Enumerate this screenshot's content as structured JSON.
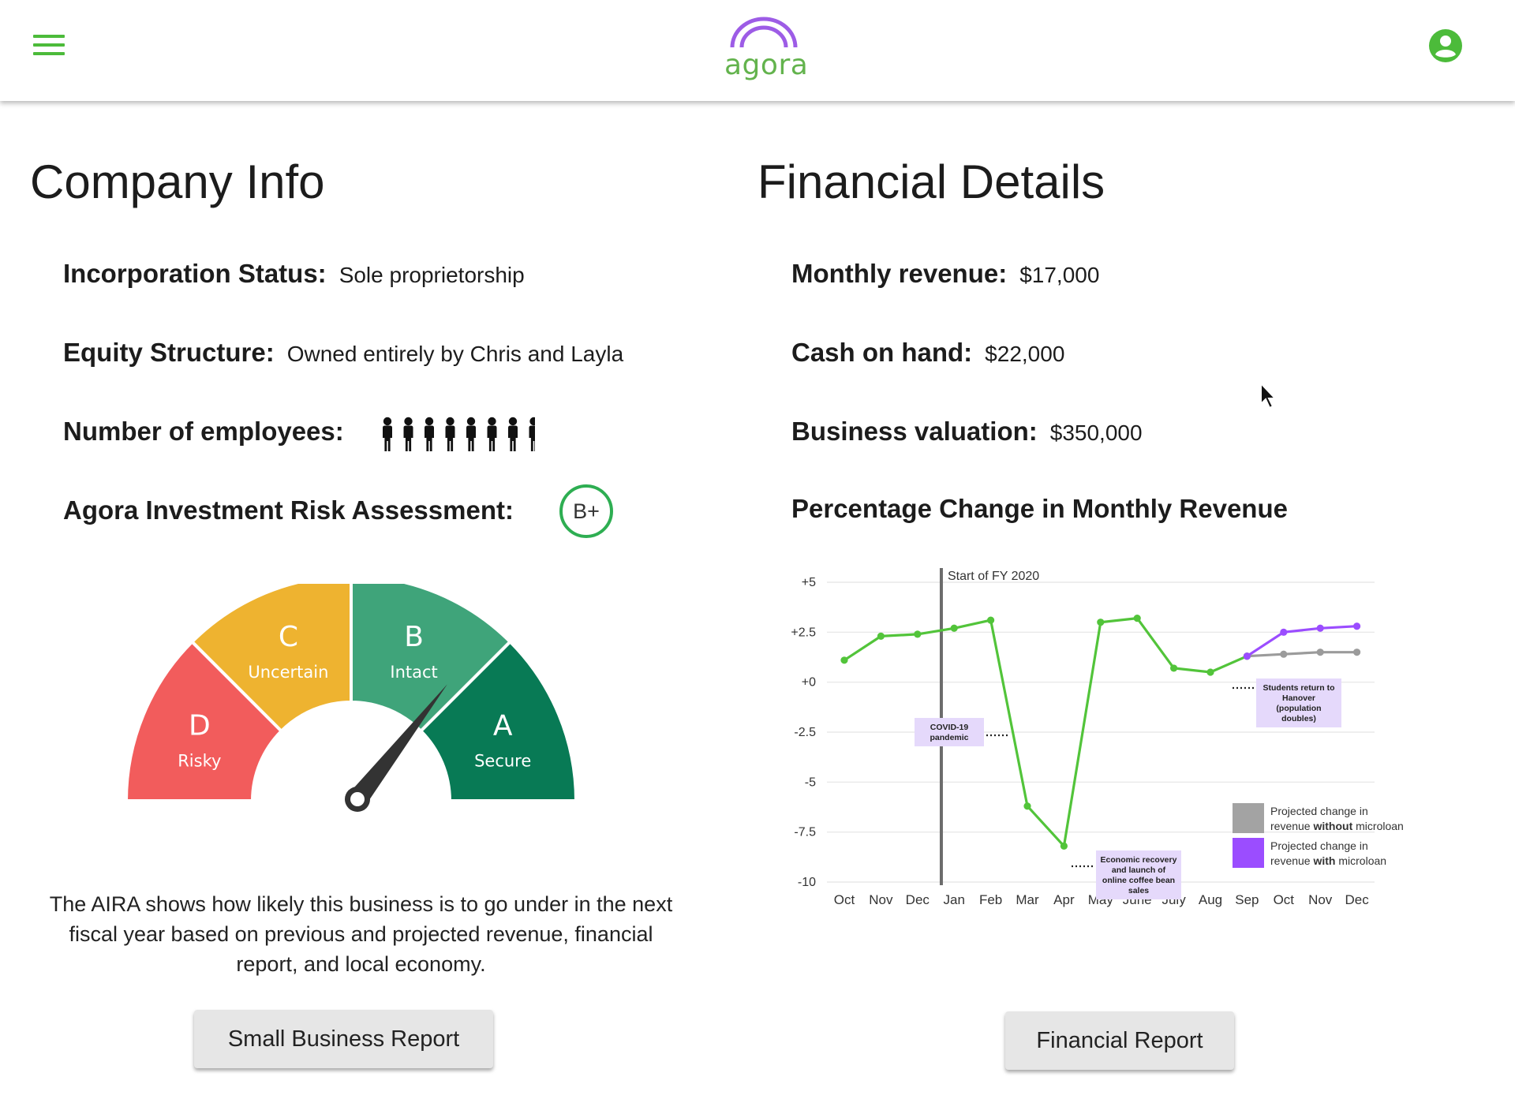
{
  "header": {
    "menu_icon": "hamburger-menu-icon",
    "logo_text": "agora",
    "account_icon": "account-circle-icon",
    "colors": {
      "accent": "#4cbb3a",
      "logo_arch": "#9d5ce6",
      "logo_text": "#63b34d"
    }
  },
  "company_info": {
    "title": "Company Info",
    "incorporation_label": "Incorporation Status:",
    "incorporation_value": "Sole proprietorship",
    "equity_label": "Equity Structure:",
    "equity_value": "Owned entirely by Chris and Layla",
    "employees_label": "Number of employees:",
    "employees_count": 8,
    "employees_icon": "person-icon",
    "risk_label": "Agora Investment Risk Assessment:",
    "risk_grade": "B+",
    "gauge": {
      "segments": [
        {
          "letter": "D",
          "label": "Risky",
          "color": "#f25c5c"
        },
        {
          "letter": "C",
          "label": "Uncertain",
          "color": "#eeb330"
        },
        {
          "letter": "B",
          "label": "Intact",
          "color": "#3fa47a"
        },
        {
          "letter": "A",
          "label": "Secure",
          "color": "#087a55"
        }
      ],
      "needle_segment": "B"
    },
    "description": "The AIRA shows how likely this business is to go under in the next fiscal year based on previous and projected revenue, financial report, and local economy.",
    "report_button": "Small Business Report"
  },
  "financial_details": {
    "title": "Financial Details",
    "monthly_revenue_label": "Monthly revenue:",
    "monthly_revenue_value": "$17,000",
    "cash_label": "Cash on hand:",
    "cash_value": "$22,000",
    "valuation_label": "Business valuation:",
    "valuation_value": "$350,000",
    "chart_title": "Percentage Change in Monthly Revenue",
    "report_button": "Financial Report"
  },
  "chart_data": {
    "type": "line",
    "title": "Percentage Change in Monthly Revenue",
    "xlabel": "",
    "ylabel": "",
    "categories": [
      "Oct",
      "Nov",
      "Dec",
      "Jan",
      "Feb",
      "Mar",
      "Apr",
      "May",
      "June",
      "July",
      "Aug",
      "Sep",
      "Oct",
      "Nov",
      "Dec"
    ],
    "yticks": [
      "+5",
      "+2.5",
      "+0",
      "-2.5",
      "-5",
      "-7.5",
      "-10"
    ],
    "ylim": [
      -10,
      5
    ],
    "grid": true,
    "series": [
      {
        "name": "",
        "color": "#52c43a",
        "start_index": 0,
        "values": [
          1.1,
          2.3,
          2.4,
          2.7,
          3.1,
          -6.2,
          -8.2,
          3.0,
          3.2,
          0.7,
          0.5,
          1.3
        ]
      },
      {
        "name": "Projected change in revenue without microloan",
        "color": "#9b9b9b",
        "start_index": 11,
        "values": [
          1.3,
          1.4,
          1.5,
          1.5
        ]
      },
      {
        "name": "Projected change in revenue with microloan",
        "color": "#9b4dff",
        "start_index": 11,
        "values": [
          1.3,
          2.5,
          2.7,
          2.8
        ]
      }
    ],
    "vertical_marker": {
      "label": "Start of FY 2020",
      "at_category_index": 2.65
    },
    "annotations": [
      {
        "text": "COVID-19 pandemic",
        "category_index": 3.2,
        "value": -1.5
      },
      {
        "text": "Economic recovery and launch of online coffee bean sales",
        "category_index": 6.3,
        "value": -7.0
      },
      {
        "text": "Students return to Hanover (population doubles)",
        "category_index": 11.1,
        "value": -0.5
      }
    ],
    "legend": {
      "placement": "bottom-right",
      "entries": [
        {
          "pre": "Projected change in revenue ",
          "bold": "without",
          "post": " microloan",
          "color": "#a3a3a3"
        },
        {
          "pre": "Projected change in revenue ",
          "bold": "with",
          "post": " microloan",
          "color": "#9b4dff"
        }
      ]
    }
  }
}
